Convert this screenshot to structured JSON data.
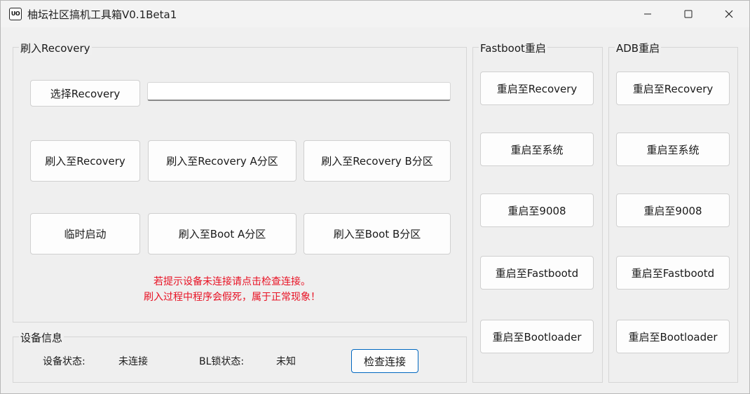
{
  "window": {
    "icon_text": "UO",
    "title": "柚坛社区搞机工具箱V0.1Beta1"
  },
  "recovery_group": {
    "label": "刷入Recovery",
    "select_button": "选择Recovery",
    "path_value": "",
    "flash_recovery": "刷入至Recovery",
    "flash_recovery_a": "刷入至Recovery A分区",
    "flash_recovery_b": "刷入至Recovery B分区",
    "temp_boot": "临时启动",
    "flash_boot_a": "刷入至Boot A分区",
    "flash_boot_b": "刷入至Boot B分区",
    "warning_line1": "若提示设备未连接请点击检查连接。",
    "warning_line2": "刷入过程中程序会假死，属于正常现象！",
    "warning_color": "#e81123"
  },
  "device_group": {
    "label": "设备信息",
    "device_status_label": "设备状态:",
    "device_status_value": "未连接",
    "bl_status_label": "BL锁状态:",
    "bl_status_value": "未知",
    "check_button": "检查连接"
  },
  "fastboot_group": {
    "label": "Fastboot重启",
    "buttons": [
      "重启至Recovery",
      "重启至系统",
      "重启至9008",
      "重启至Fastbootd",
      "重启至Bootloader"
    ]
  },
  "adb_group": {
    "label": "ADB重启",
    "buttons": [
      "重启至Recovery",
      "重启至系统",
      "重启至9008",
      "重启至Fastbootd",
      "重启至Bootloader"
    ]
  },
  "icons": {
    "minimize": "minimize-icon",
    "maximize": "maximize-icon",
    "close": "close-icon"
  },
  "colors": {
    "accent": "#0067c0",
    "background": "#f0f0f0"
  }
}
